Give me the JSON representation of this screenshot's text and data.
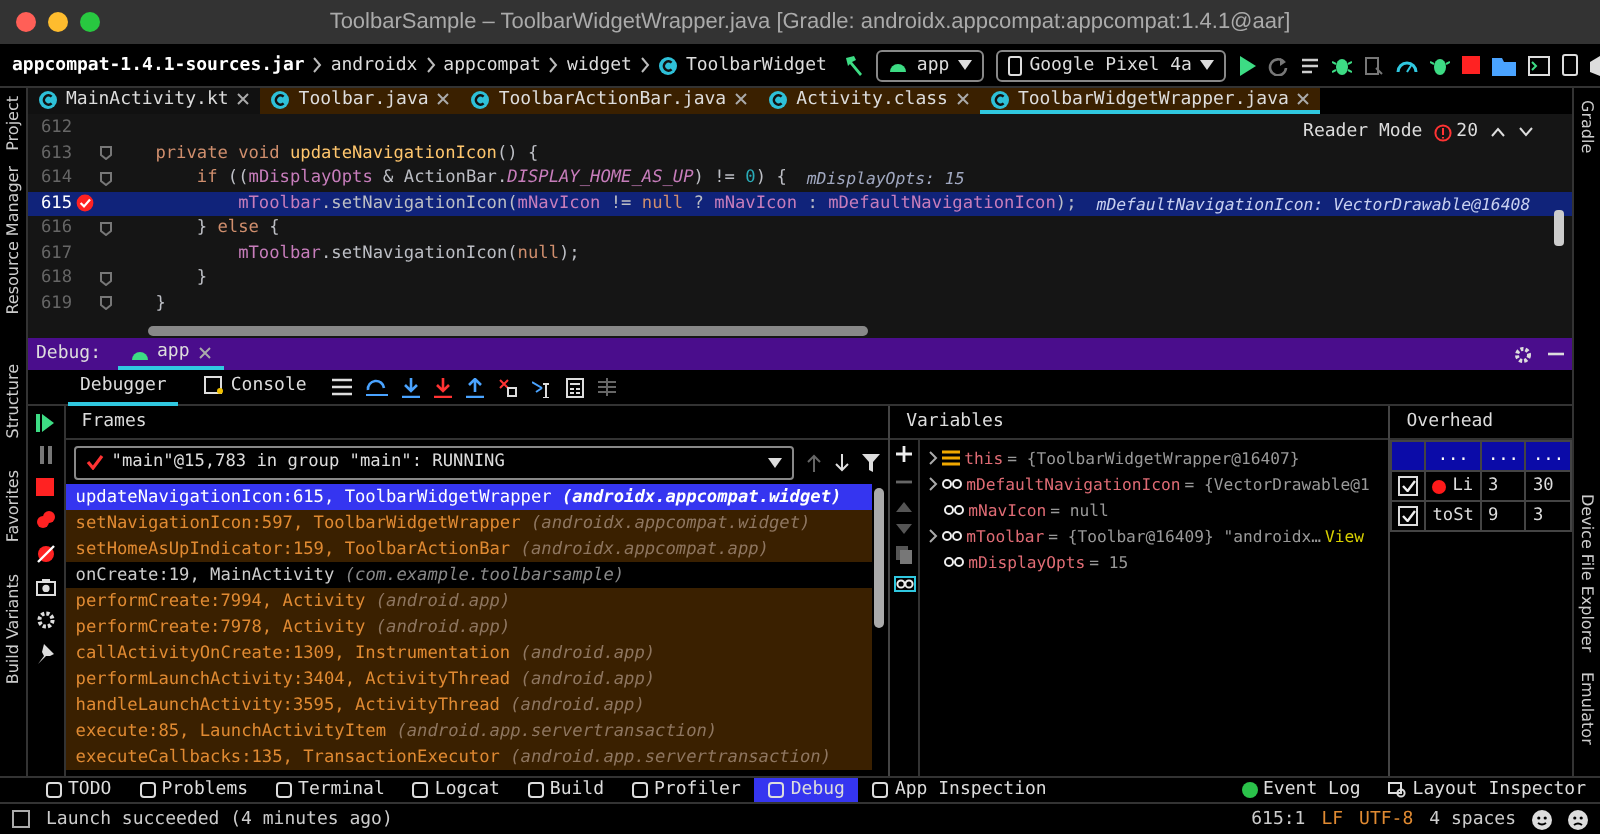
{
  "window": {
    "title": "ToolbarSample – ToolbarWidgetWrapper.java [Gradle: androidx.appcompat:appcompat:1.4.1@aar]"
  },
  "breadcrumbs": [
    "appcompat-1.4.1-sources.jar",
    "androidx",
    "appcompat",
    "widget",
    "ToolbarWidget"
  ],
  "run_config": "app",
  "device": "Google Pixel 4a",
  "left_tool_windows": [
    "Project",
    "Resource Manager",
    "Structure",
    "Favorites",
    "Build Variants"
  ],
  "right_tool_windows": [
    "Gradle",
    "Device File Explorer",
    "Emulator"
  ],
  "editor_tabs": [
    {
      "label": "MainActivity.kt",
      "library": false,
      "selected": false
    },
    {
      "label": "Toolbar.java",
      "library": true,
      "selected": false
    },
    {
      "label": "ToolbarActionBar.java",
      "library": true,
      "selected": false
    },
    {
      "label": "Activity.class",
      "library": true,
      "selected": false
    },
    {
      "label": "ToolbarWidgetWrapper.java",
      "library": true,
      "selected": true
    }
  ],
  "editor": {
    "reader_mode": "Reader Mode",
    "problem_count": "20",
    "lines": [
      {
        "number": "612",
        "current": false,
        "breakpoint": false,
        "fold": false
      },
      {
        "number": "613",
        "current": false,
        "breakpoint": false,
        "fold": true,
        "tokens": [
          {
            "text": "    private void ",
            "kind": "keyword"
          },
          {
            "text": "updateNavigationIcon",
            "kind": "method"
          },
          {
            "text": "() {",
            "kind": "plain"
          }
        ]
      },
      {
        "number": "614",
        "current": false,
        "breakpoint": false,
        "fold": true,
        "tokens": [
          {
            "text": "        if",
            "kind": "keyword"
          },
          {
            "text": " ((",
            "kind": "plain"
          },
          {
            "text": "mDisplayOpts",
            "kind": "field"
          },
          {
            "text": " & ActionBar.",
            "kind": "plain"
          },
          {
            "text": "DISPLAY_HOME_AS_UP",
            "kind": "constant"
          },
          {
            "text": ") != ",
            "kind": "plain"
          },
          {
            "text": "0",
            "kind": "number"
          },
          {
            "text": ") {",
            "kind": "plain"
          }
        ],
        "hint": "mDisplayOpts: 15"
      },
      {
        "number": "615",
        "current": true,
        "breakpoint": true,
        "fold": false,
        "tokens": [
          {
            "text": "            mToolbar",
            "kind": "field"
          },
          {
            "text": ".setNavigationIcon(",
            "kind": "plain"
          },
          {
            "text": "mNavIcon",
            "kind": "field"
          },
          {
            "text": " != ",
            "kind": "plain"
          },
          {
            "text": "null",
            "kind": "keyword"
          },
          {
            "text": " ? ",
            "kind": "plain"
          },
          {
            "text": "mNavIcon",
            "kind": "field"
          },
          {
            "text": " : ",
            "kind": "plain"
          },
          {
            "text": "mDefaultNavigationIcon",
            "kind": "field"
          },
          {
            "text": ");",
            "kind": "plain"
          }
        ],
        "hint": "mDefaultNavigationIcon: VectorDrawable@16408"
      },
      {
        "number": "616",
        "current": false,
        "breakpoint": false,
        "fold": true,
        "tokens": [
          {
            "text": "        } ",
            "kind": "plain"
          },
          {
            "text": "else",
            "kind": "keyword"
          },
          {
            "text": " {",
            "kind": "plain"
          }
        ]
      },
      {
        "number": "617",
        "current": false,
        "breakpoint": false,
        "fold": false,
        "tokens": [
          {
            "text": "            mToolbar",
            "kind": "field"
          },
          {
            "text": ".setNavigationIcon(",
            "kind": "plain"
          },
          {
            "text": "null",
            "kind": "keyword"
          },
          {
            "text": ");",
            "kind": "plain"
          }
        ]
      },
      {
        "number": "618",
        "current": false,
        "breakpoint": false,
        "fold": true,
        "tokens": [
          {
            "text": "        }",
            "kind": "plain"
          }
        ]
      },
      {
        "number": "619",
        "current": false,
        "breakpoint": false,
        "fold": true,
        "tokens": [
          {
            "text": "    }",
            "kind": "plain"
          }
        ]
      }
    ]
  },
  "debug": {
    "title": "Debug:",
    "session": "app",
    "tabs": [
      {
        "label": "Debugger",
        "selected": true
      },
      {
        "label": "Console",
        "selected": false
      }
    ],
    "frames_title": "Frames",
    "thread": "\"main\"@15,783 in group \"main\": RUNNING",
    "frames": [
      {
        "location": "updateNavigationIcon:615, ToolbarWidgetWrapper",
        "package": "(androidx.appcompat.widget)",
        "library": true,
        "selected": true
      },
      {
        "location": "setNavigationIcon:597, ToolbarWidgetWrapper",
        "package": "(androidx.appcompat.widget)",
        "library": true,
        "selected": false
      },
      {
        "location": "setHomeAsUpIndicator:159, ToolbarActionBar",
        "package": "(androidx.appcompat.app)",
        "library": true,
        "selected": false
      },
      {
        "location": "onCreate:19, MainActivity",
        "package": "(com.example.toolbarsample)",
        "library": false,
        "selected": false
      },
      {
        "location": "performCreate:7994, Activity",
        "package": "(android.app)",
        "library": true,
        "selected": false
      },
      {
        "location": "performCreate:7978, Activity",
        "package": "(android.app)",
        "library": true,
        "selected": false
      },
      {
        "location": "callActivityOnCreate:1309, Instrumentation",
        "package": "(android.app)",
        "library": true,
        "selected": false
      },
      {
        "location": "performLaunchActivity:3404, ActivityThread",
        "package": "(android.app)",
        "library": true,
        "selected": false
      },
      {
        "location": "handleLaunchActivity:3595, ActivityThread",
        "package": "(android.app)",
        "library": true,
        "selected": false
      },
      {
        "location": "execute:85, LaunchActivityItem",
        "package": "(android.app.servertransaction)",
        "library": true,
        "selected": false
      },
      {
        "location": "executeCallbacks:135, TransactionExecutor",
        "package": "(android.app.servertransaction)",
        "library": true,
        "selected": false
      }
    ],
    "variables_title": "Variables",
    "variables": [
      {
        "name": "this",
        "value": "= {ToolbarWidgetWrapper@16407}",
        "kind": "object",
        "expandable": true
      },
      {
        "name": "mDefaultNavigationIcon",
        "value": "= {VectorDrawable@1",
        "kind": "field",
        "expandable": true
      },
      {
        "name": "mNavIcon",
        "value": "= null",
        "kind": "field",
        "expandable": false
      },
      {
        "name": "mToolbar",
        "value": "= {Toolbar@16409} \"androidx…",
        "link": "View",
        "kind": "field",
        "expandable": true
      },
      {
        "name": "mDisplayOpts",
        "value": "= 15",
        "kind": "field",
        "expandable": false
      }
    ],
    "overhead_title": "Overhead",
    "overhead": {
      "columns": [
        "...",
        "...",
        "..."
      ],
      "rows": [
        {
          "checked": true,
          "color": "#ff1a1a",
          "cells": [
            "Li",
            "3",
            "30"
          ]
        },
        {
          "checked": true,
          "cells": [
            "toSt",
            "9",
            "3"
          ]
        }
      ]
    }
  },
  "tool_windows": [
    {
      "label": "TODO",
      "selected": false
    },
    {
      "label": "Problems",
      "selected": false
    },
    {
      "label": "Terminal",
      "selected": false
    },
    {
      "label": "Logcat",
      "selected": false
    },
    {
      "label": "Build",
      "selected": false
    },
    {
      "label": "Profiler",
      "selected": false
    },
    {
      "label": "Debug",
      "selected": true
    },
    {
      "label": "App Inspection",
      "selected": false
    }
  ],
  "tool_windows_right": [
    "Event Log",
    "Layout Inspector"
  ],
  "status_bar": {
    "message": "Launch succeeded (4 minutes ago)",
    "position": "615:1",
    "line_separator": "LF",
    "encoding": "UTF-8",
    "indent": "4 spaces"
  }
}
